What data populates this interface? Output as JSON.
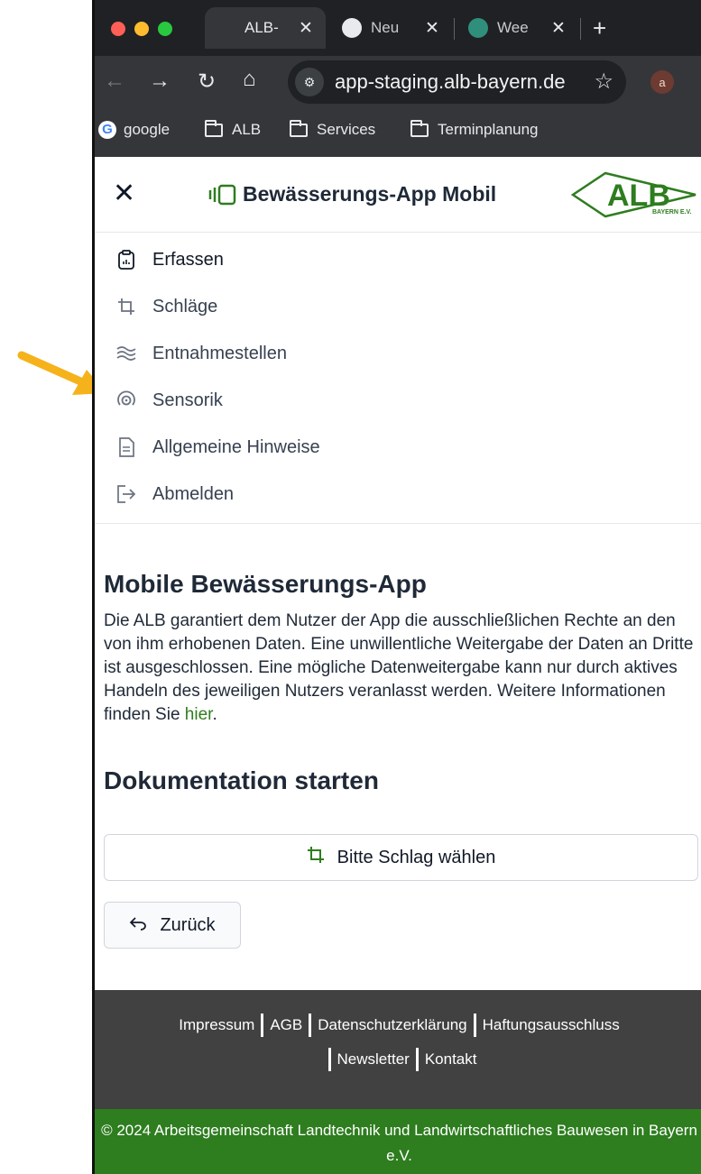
{
  "browser": {
    "tabs": [
      {
        "title": "ALB-",
        "active": true
      },
      {
        "title": "Neu"
      },
      {
        "title": "Wee"
      }
    ],
    "new_tab": "+",
    "close_glyph": "✕",
    "url": "app-staging.alb-bayern.de",
    "profile_initial": "a",
    "bookmarks": [
      {
        "label": "google",
        "icon": "google-icon"
      },
      {
        "label": "ALB",
        "icon": "folder-icon"
      },
      {
        "label": "Services",
        "icon": "folder-icon"
      },
      {
        "label": "Terminplanung",
        "icon": "folder-icon"
      }
    ]
  },
  "app": {
    "title": "Bewässerungs-App Mobil",
    "logo_text": "ALB",
    "logo_sub": "BAYERN E.V.",
    "brand_color": "#2e7d1f"
  },
  "menu": {
    "items": [
      {
        "label": "Erfassen",
        "icon": "clipboard-icon"
      },
      {
        "label": "Schläge",
        "icon": "crop-icon"
      },
      {
        "label": "Entnahmestellen",
        "icon": "waves-icon"
      },
      {
        "label": "Sensorik",
        "icon": "sensor-icon"
      },
      {
        "label": "Allgemeine Hinweise",
        "icon": "document-icon"
      },
      {
        "label": "Abmelden",
        "icon": "logout-icon"
      }
    ]
  },
  "main": {
    "heading": "Mobile Bewässerungs-App",
    "intro": "Die ALB garantiert dem Nutzer der App die ausschließlichen Rechte an den von ihm erhobenen Daten. Eine unwillentliche Weitergabe der Daten an Dritte ist ausgeschlossen. Eine mögliche Datenweitergabe kann nur durch aktives Handeln des jeweiligen Nutzers veranlasst werden. Weitere Informationen finden Sie ",
    "intro_link": "hier",
    "intro_end": ".",
    "subheading": "Dokumentation starten",
    "choose_plot": "Bitte Schlag wählen",
    "back": "Zurück"
  },
  "footer": {
    "links": [
      "Impressum",
      "AGB",
      "Datenschutzerklärung",
      "Haftungsausschluss",
      "Newsletter",
      "Kontakt"
    ],
    "copyright": "© 2024 Arbeitsgemeinschaft Landtechnik und Landwirtschaftliches Bauwesen in Bayern e.V."
  },
  "annotation": {
    "arrow_color": "#f5b21b"
  }
}
